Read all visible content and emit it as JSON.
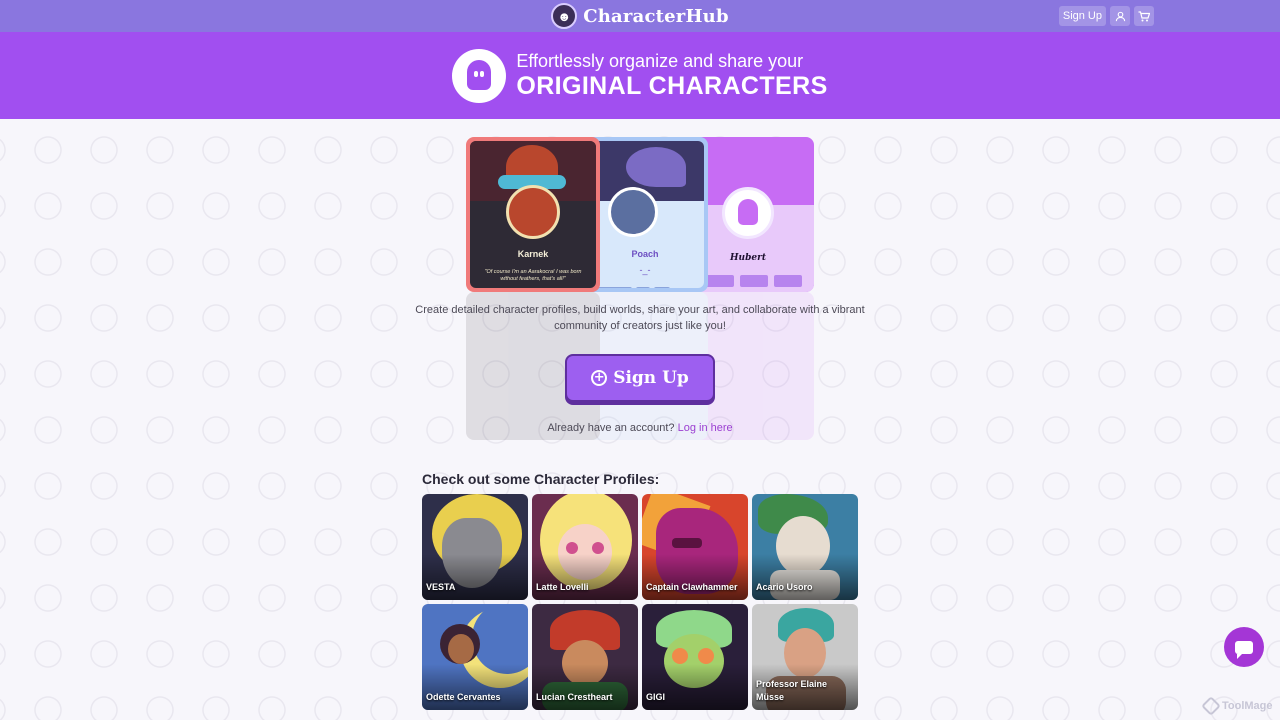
{
  "header": {
    "brand": "CharacterHub",
    "signup_label": "Sign Up",
    "user_icon": "user-icon",
    "cart_icon": "cart-icon"
  },
  "hero": {
    "line1": "Effortlessly organize and share your",
    "line2": "ORIGINAL CHARACTERS"
  },
  "showcase": {
    "cards": [
      {
        "name": "Karnek",
        "quote": "\"Of course I'm an Aarakocra! I was born without feathers, that's all!\"",
        "color": "#f07a7a"
      },
      {
        "name": "Poach",
        "subtitle": "-_-",
        "color": "#a8c7f5"
      },
      {
        "name": "Hubert",
        "color": "#c76cf4"
      }
    ]
  },
  "intro": {
    "text": "Create detailed character profiles, build worlds, share your art, and collaborate with a vibrant community of creators just like you!"
  },
  "cta": {
    "signup_label": "Sign Up",
    "login_prompt": "Already have an account?",
    "login_link": "Log in here"
  },
  "profiles": {
    "title": "Check out some Character Profiles:",
    "items": [
      {
        "name": "VESTA",
        "bg": "#2e2f4a",
        "accent": "#e9cf4e"
      },
      {
        "name": "Latte Lovelli",
        "bg": "#6b2d4f",
        "accent": "#f6e27a"
      },
      {
        "name": "Captain Clawhammer",
        "bg": "#d8452c",
        "accent": "#a8267c"
      },
      {
        "name": "Acario Usoro",
        "bg": "#3c7fa4",
        "accent": "#e6dcd0"
      },
      {
        "name": "Odette Cervantes",
        "bg": "#4f74c2",
        "accent": "#f3e27a"
      },
      {
        "name": "Lucian Crestheart",
        "bg": "#3d2a42",
        "accent": "#c23b2a"
      },
      {
        "name": "GIGI",
        "bg": "#2a1f3a",
        "accent": "#8fd88a"
      },
      {
        "name": "Professor Elaine Müsse",
        "bg": "#c9c9c9",
        "accent": "#3aa6a0"
      }
    ]
  },
  "watermark": "ToolMage"
}
